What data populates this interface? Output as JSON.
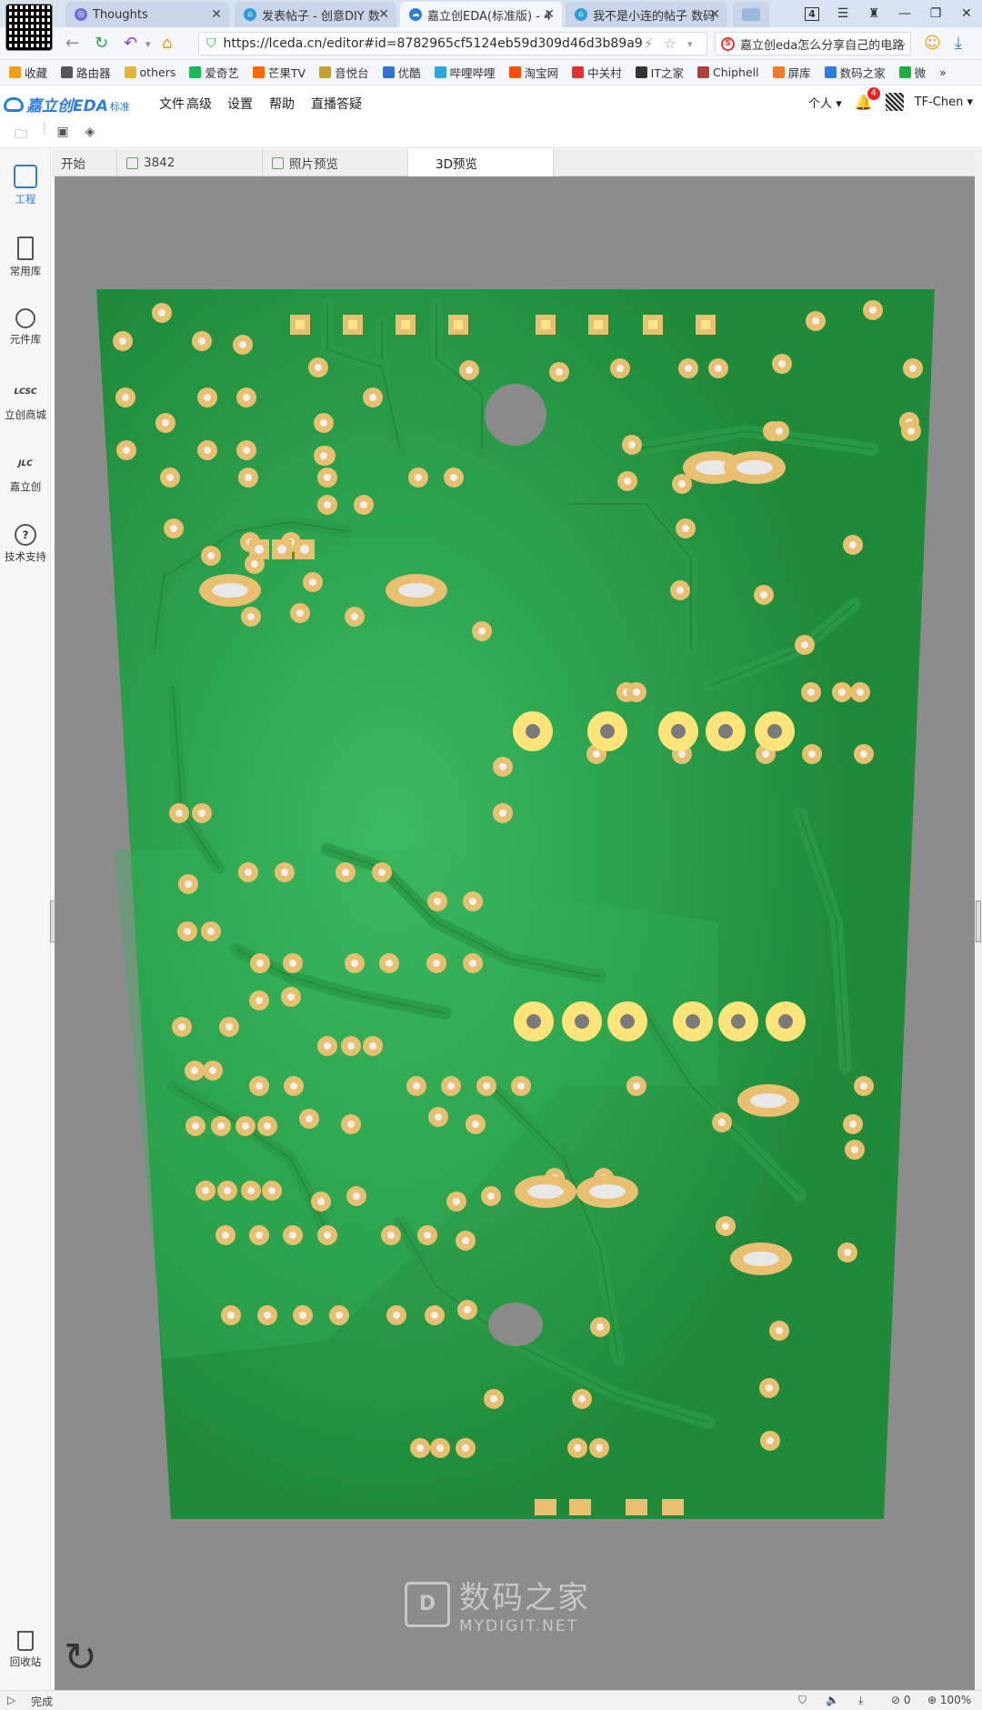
{
  "browser": {
    "tabs": [
      {
        "title": "Thoughts",
        "color": "#6b6fd6",
        "active": false
      },
      {
        "title": "发表帖子 - 创意DIY 数",
        "color": "#2e9be0",
        "active": false
      },
      {
        "title": "嘉立创EDA(标准版) - 4",
        "color": "#2e7ee0",
        "active": true
      },
      {
        "title": "我不是小连的帖子 数码",
        "color": "#2e9be0",
        "active": false
      }
    ],
    "tab_count_badge": "4",
    "url": "https://lceda.cn/editor#id=8782965cf5124eb59d309d46d3b89a9",
    "search_text": "嘉立创eda怎么分享自己的电路",
    "bookmarks": [
      "收藏",
      "路由器",
      "others",
      "爱奇艺",
      "芒果TV",
      "音悦台",
      "优酷",
      "哔哩哔哩",
      "淘宝网",
      "中关村",
      "IT之家",
      "Chiphell",
      "屏库",
      "数码之家",
      "微"
    ],
    "bookmark_colors": [
      "#f0a020",
      "#555555",
      "#e8b33a",
      "#19b955",
      "#ff6a00",
      "#c8a030",
      "#2e74d8",
      "#2ea7e0",
      "#ff5000",
      "#e83030",
      "#333333",
      "#b04040",
      "#f07a2a",
      "#2e7ee0",
      "#20b040"
    ]
  },
  "app": {
    "logo_text": "嘉立创EDA",
    "edition": "标准",
    "menus": [
      "文件",
      "高级",
      "设置",
      "帮助",
      "直播答疑"
    ],
    "user_menu": "个人",
    "notification_count": "4",
    "username": "TF-Chen"
  },
  "sidebar": {
    "items": [
      {
        "label": "工程",
        "icon": "folder-icon",
        "active": true
      },
      {
        "label": "常用库",
        "icon": "chip-icon",
        "active": false
      },
      {
        "label": "元件库",
        "icon": "search-icon",
        "active": false
      },
      {
        "label": "立创商城",
        "icon": "lcsc-icon",
        "active": false
      },
      {
        "label": "嘉立创",
        "icon": "jlc-icon",
        "active": false
      },
      {
        "label": "技术支持",
        "icon": "help-icon",
        "active": false
      }
    ],
    "trash_label": "回收站"
  },
  "doc_tabs": [
    {
      "label": "开始",
      "active": false
    },
    {
      "label": "3842",
      "active": false
    },
    {
      "label": "照片预览",
      "active": false
    },
    {
      "label": "3D预览",
      "active": true
    }
  ],
  "watermark": {
    "logo": "D",
    "title": "数码之家",
    "subtitle": "MYDIGIT.NET"
  },
  "statusbar": {
    "status": "完成",
    "count": "0",
    "zoom": "100%"
  },
  "colors": {
    "board": "#1f8a3a",
    "board_light": "#35b15a",
    "trace": "#2a9a45",
    "pad": "#e8c070",
    "canvas_bg": "#8c8c8c",
    "accent": "#2e7ee0"
  }
}
